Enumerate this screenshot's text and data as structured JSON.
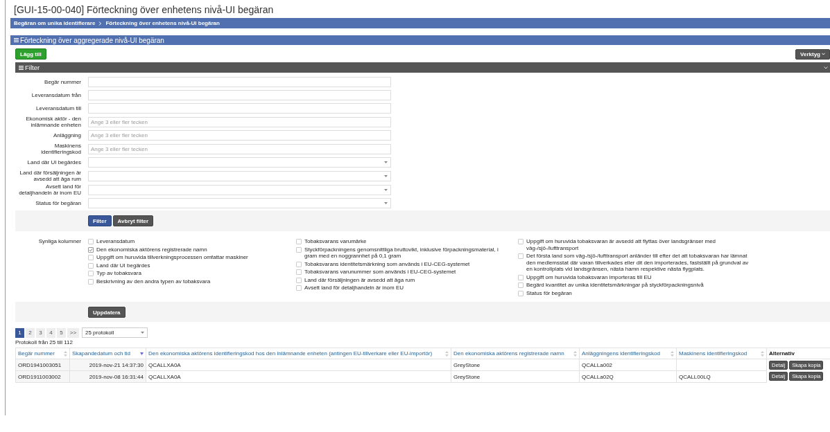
{
  "title": "[GUI-15-00-040] Förteckning över enhetens nivå-UI begäran",
  "breadcrumb": [
    {
      "label": "Begäran om unika identifierare"
    },
    {
      "label": "Förteckning över enhetens nivå-UI begäran"
    }
  ],
  "panel": {
    "title": "Förteckning över aggregerade nivå-UI begäran",
    "add_button": "Lägg till",
    "tools_button": "Verktyg"
  },
  "filter": {
    "title": "Filter",
    "fields": [
      {
        "label": "Begär nummer",
        "kind": "text"
      },
      {
        "label": "Leveransdatum från",
        "kind": "text"
      },
      {
        "label": "Leveransdatum till",
        "kind": "text"
      },
      {
        "label": "Ekonomisk aktör - den inlämnande enheten",
        "kind": "text",
        "placeholder": "Ange 3 eller fler tecken"
      },
      {
        "label": "Anläggning",
        "kind": "text",
        "placeholder": "Ange 3 eller fler tecken"
      },
      {
        "label": "Maskinens identifieringskod",
        "kind": "text",
        "placeholder": "Ange 3 eller fler tecken"
      },
      {
        "label": "Land där UI begärdes",
        "kind": "select"
      },
      {
        "label": "Land där försäljningen är avsedd att äga rum",
        "kind": "select"
      },
      {
        "label": "Avsett land för detaljhandeln är inom EU",
        "kind": "select"
      },
      {
        "label": "Status för begäran",
        "kind": "select"
      }
    ],
    "filter_button": "Filter",
    "cancel_button": "Avbryt filter"
  },
  "visible_columns": {
    "label": "Synliga kolumner",
    "groups": [
      [
        {
          "label": "Leveransdatum",
          "checked": false
        },
        {
          "label": "Den ekonomiska aktörens registrerade namn",
          "checked": true
        },
        {
          "label": "Uppgift om huruvida tillverkningsprocessen omfattar maskiner",
          "checked": false
        },
        {
          "label": "Land där UI begärdes",
          "checked": false
        },
        {
          "label": "Typ av tobaksvara",
          "checked": false
        },
        {
          "label": "Beskrivning av den andra typen av tobaksvara",
          "checked": false
        }
      ],
      [
        {
          "label": "Tobaksvarans varumärke",
          "checked": false
        },
        {
          "label": "Styckförpackningens genomsnittliga bruttovikt, inklusive förpackningsmaterial, i gram med en noggrannhet på 0,1 gram",
          "checked": false
        },
        {
          "label": "Tobaksvarans identitetsmärkning som används i EU-CEG-systemet",
          "checked": false
        },
        {
          "label": "Tobaksvarans varunummer som används i EU-CEG-systemet",
          "checked": false
        },
        {
          "label": "Land där försäljningen är avsedd att äga rum",
          "checked": false
        },
        {
          "label": "Avsett land för detaljhandeln är inom EU",
          "checked": false
        }
      ],
      [
        {
          "label": "Uppgift om huruvida tobaksvaran är avsedd att flyttas över landsgränser med väg-/sjö-/lufttransport",
          "checked": false
        },
        {
          "label": "Det första land som väg-/sjö-/lufttransport anländer till efter det att tobaksvaran har lämnat den medlemsstat där varan tillverkades eller dit den importerades, fastställt på grundval av en kontrollplats vid landsgränsen, nästa hamn respektive nästa flygplats.",
          "checked": false
        },
        {
          "label": "Uppgift om huruvida tobaksvaran importeras till EU",
          "checked": false
        },
        {
          "label": "Begärd kvantitet av unika identitetsmärkningar på styckförpackningsnivå",
          "checked": false
        },
        {
          "label": "Status för begäran",
          "checked": false
        }
      ]
    ],
    "update_button": "Uppdatera"
  },
  "pagination": {
    "pages": [
      {
        "label": "1",
        "selected": true
      },
      {
        "label": "2",
        "selected": false
      },
      {
        "label": "3",
        "selected": false
      },
      {
        "label": "4",
        "selected": false
      },
      {
        "label": "5",
        "selected": false
      }
    ],
    "next": ">>",
    "page_size": "25 protokoll",
    "record_info": "Protokoll från 25 till 112"
  },
  "table": {
    "columns": [
      {
        "label": "Begär nummer",
        "sortable": true,
        "sorted": false
      },
      {
        "label": "Skapandedatum och tid",
        "sortable": true,
        "sorted": true
      },
      {
        "label": "Den ekonomiska aktörens identifieringskod hos den inlämnande enheten (antingen EU-tillverkare eller EU-importör)",
        "sortable": true,
        "sorted": false
      },
      {
        "label": "Den ekonomiska aktörens registrerade namn",
        "sortable": true,
        "sorted": false
      },
      {
        "label": "Anläggningens identifieringskod",
        "sortable": true,
        "sorted": false
      },
      {
        "label": "Maskinens identifieringskod",
        "sortable": true,
        "sorted": false
      },
      {
        "label": "Alternativ",
        "sortable": false
      }
    ],
    "rows": [
      {
        "cells": [
          "ORD1941003051",
          "2019-nov-21 14:37:30",
          "QCALLXA0A",
          "GreyStone",
          "QCALLa002",
          ""
        ],
        "actions": [
          "Detalj",
          "Skapa kopia"
        ]
      },
      {
        "cells": [
          "ORD1911003002",
          "2019-nov-08 16:31:44",
          "QCALLXA0A",
          "GreyStone",
          "QCALLa02Q",
          "QCALL00LQ"
        ],
        "actions": [
          "Detalj",
          "Skapa kopia"
        ]
      }
    ]
  }
}
